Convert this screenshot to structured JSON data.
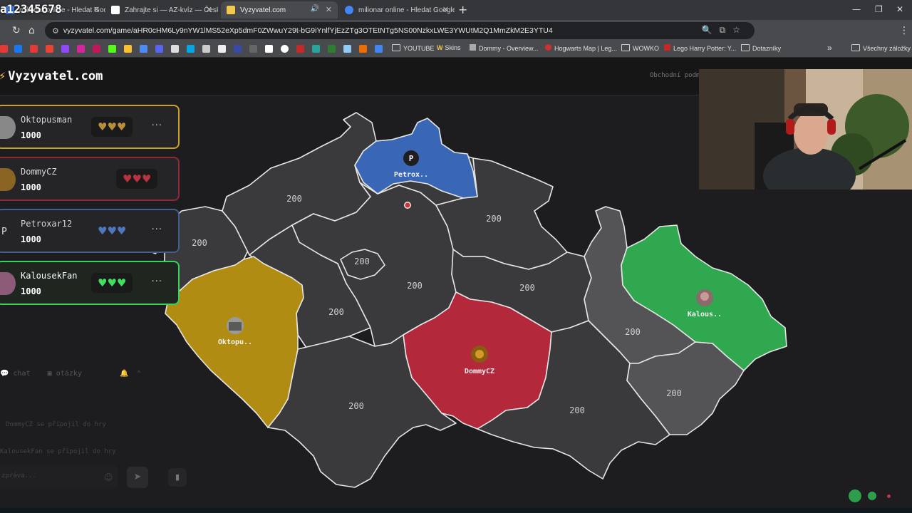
{
  "browser": {
    "overlay_username": "a12345678",
    "tabs": [
      {
        "title": "milionar online - Hledat Googlem",
        "active": false
      },
      {
        "title": "Zahrajte si — AZ-kvíz — Česká",
        "active": false
      },
      {
        "title": "Vyzyvatel.com",
        "active": true
      },
      {
        "title": "milionar online - Hledat Google",
        "active": false
      }
    ],
    "url": "vyzyvatel.com/game/aHR0cHM6Ly9nYW1lMS52eXp5dmF0ZWwuY29t-bG9iYnlfYjEzZTg3OTEtNTg5NS00NzkxLWE3YWUtM2Q1MmZkM2E3YTU4",
    "bookmarks": [
      {
        "label": "YOUTUBE",
        "type": "folder"
      },
      {
        "label": "Skins",
        "type": "link"
      },
      {
        "label": "Dommy - Overview...",
        "type": "link"
      },
      {
        "label": "Hogwarts Map | Leg...",
        "type": "link"
      },
      {
        "label": "WOWKO",
        "type": "folder"
      },
      {
        "label": "Lego Harry Potter: Y...",
        "type": "link"
      },
      {
        "label": "Dotazníky",
        "type": "folder"
      }
    ],
    "all_bookmarks": "Všechny záložky",
    "more_bookmarks": "»"
  },
  "site": {
    "logo": "Vyzyvatel.com",
    "header_link": "Obchodní podm"
  },
  "players": [
    {
      "name": "Oktopusman",
      "score": "1000",
      "color": "#c9a227",
      "heart_color": "#b8903a",
      "avatar": "photo",
      "active": false
    },
    {
      "name": "DommyCZ",
      "score": "1000",
      "color": "#a8333f",
      "heart_color": "#b83240",
      "avatar": "photo",
      "active": false
    },
    {
      "name": "Petroxar12",
      "score": "1000",
      "color": "#4a6fa8",
      "heart_color": "#4f77c0",
      "avatar": "P",
      "active": false
    },
    {
      "name": "KalousekFan",
      "score": "1000",
      "color": "#36d45c",
      "heart_color": "#3fe060",
      "avatar": "photo",
      "active": true
    }
  ],
  "hearts": "♥♥♥",
  "more_menu": "···",
  "chat": {
    "tab_chat": "chat",
    "tab_otazky": "otázky",
    "messages": [
      "DommyCZ se připojil do hry",
      "KalousekFan se připojil do hry"
    ],
    "placeholder": "zpráva..."
  },
  "map": {
    "region_value": "200",
    "owners": [
      {
        "player": "Petroxar12",
        "label": "Petrox..",
        "avatar_letter": "P",
        "color": "#3a67b5"
      },
      {
        "player": "Oktopusman",
        "label": "Oktopu..",
        "color": "#b08d12"
      },
      {
        "player": "DommyCZ",
        "label": "DommyCZ",
        "color": "#b3283a"
      },
      {
        "player": "KalousekFan",
        "label": "Kalous..",
        "color": "#2fa84f"
      }
    ],
    "unclaimed_color": "#3a3a3c",
    "highlight_color": "#545457"
  }
}
